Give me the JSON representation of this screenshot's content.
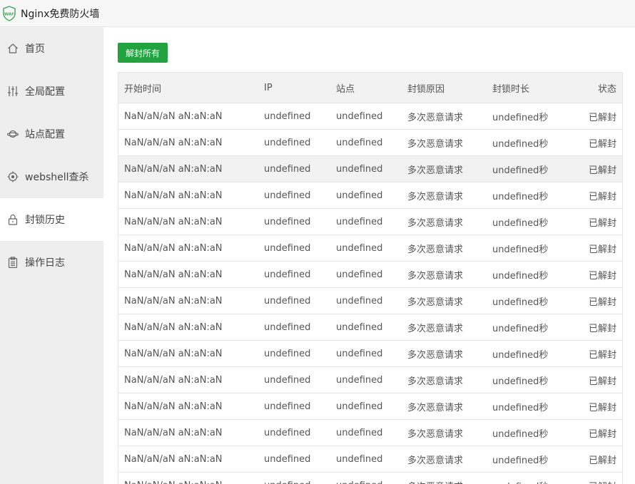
{
  "app": {
    "title": "Nginx免费防火墙",
    "logo_text": "WAF"
  },
  "sidebar": {
    "items": [
      {
        "label": "首页",
        "icon": "home-icon",
        "active": false
      },
      {
        "label": "全局配置",
        "icon": "sliders-icon",
        "active": false
      },
      {
        "label": "站点配置",
        "icon": "planet-icon",
        "active": false
      },
      {
        "label": "webshell查杀",
        "icon": "target-icon",
        "active": false
      },
      {
        "label": "封锁历史",
        "icon": "lock-icon",
        "active": true
      },
      {
        "label": "操作日志",
        "icon": "clipboard-icon",
        "active": false
      }
    ]
  },
  "toolbar": {
    "unban_all_label": "解封所有"
  },
  "table": {
    "headers": [
      "开始时间",
      "IP",
      "站点",
      "封锁原因",
      "封锁时长",
      "状态"
    ],
    "rows": [
      [
        "NaN/aN/aN aN:aN:aN",
        "undefined",
        "undefined",
        "多次恶意请求",
        "undefined秒",
        "已解封"
      ],
      [
        "NaN/aN/aN aN:aN:aN",
        "undefined",
        "undefined",
        "多次恶意请求",
        "undefined秒",
        "已解封"
      ],
      [
        "NaN/aN/aN aN:aN:aN",
        "undefined",
        "undefined",
        "多次恶意请求",
        "undefined秒",
        "已解封"
      ],
      [
        "NaN/aN/aN aN:aN:aN",
        "undefined",
        "undefined",
        "多次恶意请求",
        "undefined秒",
        "已解封"
      ],
      [
        "NaN/aN/aN aN:aN:aN",
        "undefined",
        "undefined",
        "多次恶意请求",
        "undefined秒",
        "已解封"
      ],
      [
        "NaN/aN/aN aN:aN:aN",
        "undefined",
        "undefined",
        "多次恶意请求",
        "undefined秒",
        "已解封"
      ],
      [
        "NaN/aN/aN aN:aN:aN",
        "undefined",
        "undefined",
        "多次恶意请求",
        "undefined秒",
        "已解封"
      ],
      [
        "NaN/aN/aN aN:aN:aN",
        "undefined",
        "undefined",
        "多次恶意请求",
        "undefined秒",
        "已解封"
      ],
      [
        "NaN/aN/aN aN:aN:aN",
        "undefined",
        "undefined",
        "多次恶意请求",
        "undefined秒",
        "已解封"
      ],
      [
        "NaN/aN/aN aN:aN:aN",
        "undefined",
        "undefined",
        "多次恶意请求",
        "undefined秒",
        "已解封"
      ],
      [
        "NaN/aN/aN aN:aN:aN",
        "undefined",
        "undefined",
        "多次恶意请求",
        "undefined秒",
        "已解封"
      ],
      [
        "NaN/aN/aN aN:aN:aN",
        "undefined",
        "undefined",
        "多次恶意请求",
        "undefined秒",
        "已解封"
      ],
      [
        "NaN/aN/aN aN:aN:aN",
        "undefined",
        "undefined",
        "多次恶意请求",
        "undefined秒",
        "已解封"
      ],
      [
        "NaN/aN/aN aN:aN:aN",
        "undefined",
        "undefined",
        "多次恶意请求",
        "undefined秒",
        "已解封"
      ],
      [
        "NaN/aN/aN aN:aN:aN",
        "undefined",
        "undefined",
        "多次恶意请求",
        "undefined秒",
        "已解封"
      ]
    ]
  },
  "colors": {
    "accent": "#22a340",
    "sidebar_bg": "#eeeeee",
    "header_row_bg": "#f2f2f2"
  }
}
